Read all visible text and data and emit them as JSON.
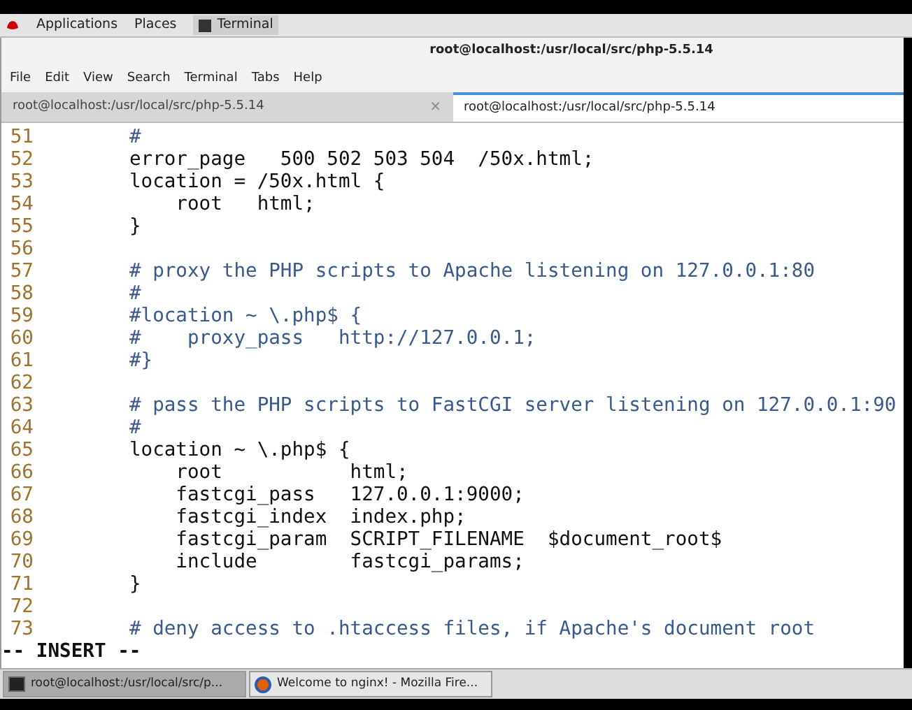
{
  "top_panel": {
    "menus": [
      "Applications",
      "Places"
    ],
    "app": "Terminal"
  },
  "window": {
    "title": "root@localhost:/usr/local/src/php-5.5.14"
  },
  "menu_bar": [
    "File",
    "Edit",
    "View",
    "Search",
    "Terminal",
    "Tabs",
    "Help"
  ],
  "tabs": [
    {
      "label": "root@localhost:/usr/local/src/php-5.5.14",
      "selected": false,
      "close": "×"
    },
    {
      "label": "root@localhost:/usr/local/src/php-5.5.14",
      "selected": true
    }
  ],
  "lines": [
    {
      "number": "51",
      "kind": "comment",
      "text": "        #"
    },
    {
      "number": "52",
      "kind": "code",
      "text": "        error_page   500 502 503 504  /50x.html;"
    },
    {
      "number": "53",
      "kind": "code",
      "text": "        location = /50x.html {"
    },
    {
      "number": "54",
      "kind": "code",
      "text": "            root   html;"
    },
    {
      "number": "55",
      "kind": "code",
      "text": "        }"
    },
    {
      "number": "56",
      "kind": "blank"
    },
    {
      "number": "57",
      "kind": "comment",
      "text": "        # proxy the PHP scripts to Apache listening on 127.0.0.1:80"
    },
    {
      "number": "58",
      "kind": "comment",
      "text": "        #"
    },
    {
      "number": "59",
      "kind": "comment",
      "text": "        #location ~ \\.php$ {"
    },
    {
      "number": "60",
      "kind": "comment",
      "text": "        #    proxy_pass   http://127.0.0.1;"
    },
    {
      "number": "61",
      "kind": "comment",
      "text": "        #}"
    },
    {
      "number": "62",
      "kind": "blank"
    },
    {
      "number": "63",
      "kind": "comment",
      "text": "        # pass the PHP scripts to FastCGI server listening on 127.0.0.1:90"
    },
    {
      "number": "64",
      "kind": "comment",
      "text": "        #"
    },
    {
      "number": "65",
      "kind": "code",
      "text": "        location ~ \\.php$ {"
    },
    {
      "number": "66",
      "kind": "code",
      "text": "            root           html;"
    },
    {
      "number": "67",
      "kind": "code",
      "text": "            fastcgi_pass   127.0.0.1:9000;"
    },
    {
      "number": "68",
      "kind": "code",
      "text": "            fastcgi_index  index.php;"
    },
    {
      "number": "69",
      "kind": "code",
      "text": "            fastcgi_param  SCRIPT_FILENAME  $document_root$"
    },
    {
      "number": "70",
      "kind": "code",
      "text": "            include        fastcgi_params;"
    },
    {
      "number": "71",
      "kind": "code",
      "text": "        }"
    },
    {
      "number": "72",
      "kind": "blank"
    },
    {
      "number": "73",
      "kind": "comment",
      "text": "        # deny access to .htaccess files, if Apache's document root"
    }
  ],
  "mode": "-- INSERT --",
  "taskbar": [
    {
      "label": "root@localhost:/usr/local/src/p...",
      "kind": "terminal",
      "selected": true
    },
    {
      "label": "Welcome to nginx! - Mozilla Fire...",
      "kind": "browser",
      "selected": false
    }
  ]
}
